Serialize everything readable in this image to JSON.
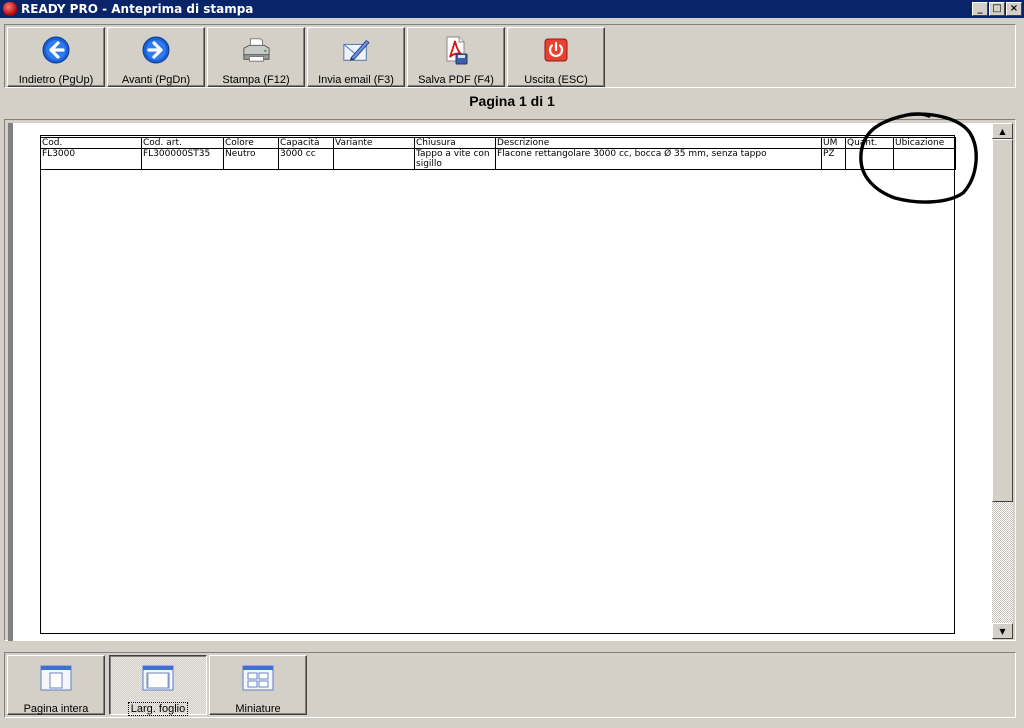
{
  "window": {
    "title": "READY PRO - Anteprima di stampa",
    "controls": {
      "minimize": "_",
      "maximize": "□",
      "close": "×"
    }
  },
  "toolbar": {
    "buttons": [
      {
        "label": "Indietro (PgUp)",
        "icon": "arrow-left-icon"
      },
      {
        "label": "Avanti (PgDn)",
        "icon": "arrow-right-icon"
      },
      {
        "label": "Stampa (F12)",
        "icon": "printer-icon"
      },
      {
        "label": "Invia email (F3)",
        "icon": "email-icon"
      },
      {
        "label": "Salva PDF (F4)",
        "icon": "pdf-icon"
      },
      {
        "label": "Uscita (ESC)",
        "icon": "power-icon"
      }
    ]
  },
  "page_indicator": "Pagina 1 di 1",
  "report": {
    "headers": [
      "Cod.",
      "Cod. art.",
      "Colore",
      "Capacità",
      "Variante",
      "Chiusura",
      "Descrizione",
      "UM",
      "Quant.",
      "Ubicazione"
    ],
    "rows": [
      [
        "FL3000",
        "FL300000ST35",
        "Neutro",
        "3000 cc",
        "",
        "Tappo a vite con sigillo",
        "Flacone rettangolare 3000 cc, bocca Ø 35 mm, senza tappo",
        "PZ",
        "",
        ""
      ]
    ]
  },
  "scrollbar": {
    "up": "▲",
    "down": "▼"
  },
  "viewbar": {
    "buttons": [
      {
        "label": "Pagina intera",
        "icon": "full-page-icon"
      },
      {
        "label": "Larg. foglio",
        "icon": "page-width-icon",
        "selected": true
      },
      {
        "label": "Miniature",
        "icon": "thumbnails-icon"
      }
    ]
  },
  "colors": {
    "titlebar": "#0a246a",
    "face": "#d4d0c8",
    "annotation": "#000000"
  }
}
